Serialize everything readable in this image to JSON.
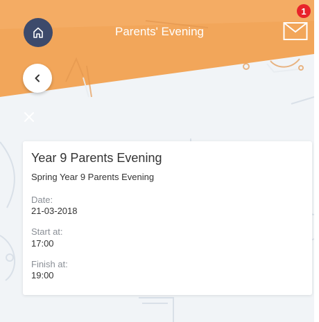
{
  "header": {
    "title": "Parents' Evening",
    "home_icon": "home-icon",
    "mail_icon": "mail-icon",
    "unread_count": "1",
    "accent_color": "#f2a65a"
  },
  "navigation": {
    "back_icon": "chevron-left-icon",
    "close_icon": "close-icon"
  },
  "event": {
    "title": "Year 9 Parents Evening",
    "subtitle": "Spring Year 9 Parents Evening",
    "date_label": "Date:",
    "date_value": "21-03-2018",
    "start_label": "Start at:",
    "start_value": "17:00",
    "finish_label": "Finish at:",
    "finish_value": "19:00"
  }
}
